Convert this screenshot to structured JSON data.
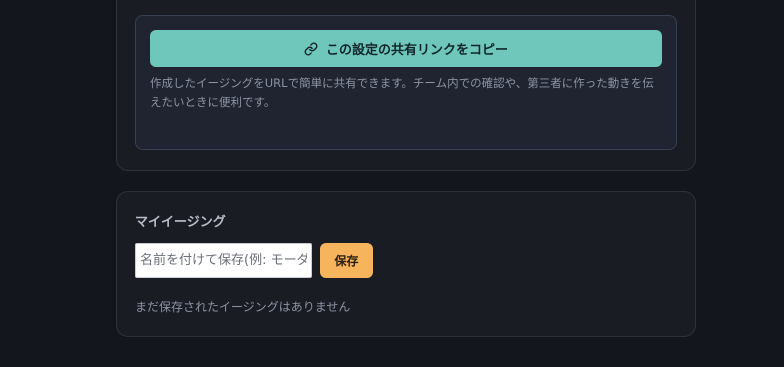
{
  "share": {
    "copy_button_label": "この設定の共有リンクをコピー",
    "copy_button_icon": "link-icon",
    "description": "作成したイージングをURLで簡単に共有できます。チーム内での確認や、第三者に作った動きを伝えたいときに便利です。"
  },
  "my_easing": {
    "title": "マイイージング",
    "name_input_placeholder": "名前を付けて保存(例: モーダル開閉)",
    "name_input_value": "",
    "save_label": "保存",
    "empty_message": "まだ保存されたイージングはありません"
  },
  "colors": {
    "copy_button_bg": "#6fc7bb",
    "save_button_bg": "#f6b45c",
    "page_bg": "#14161d"
  }
}
